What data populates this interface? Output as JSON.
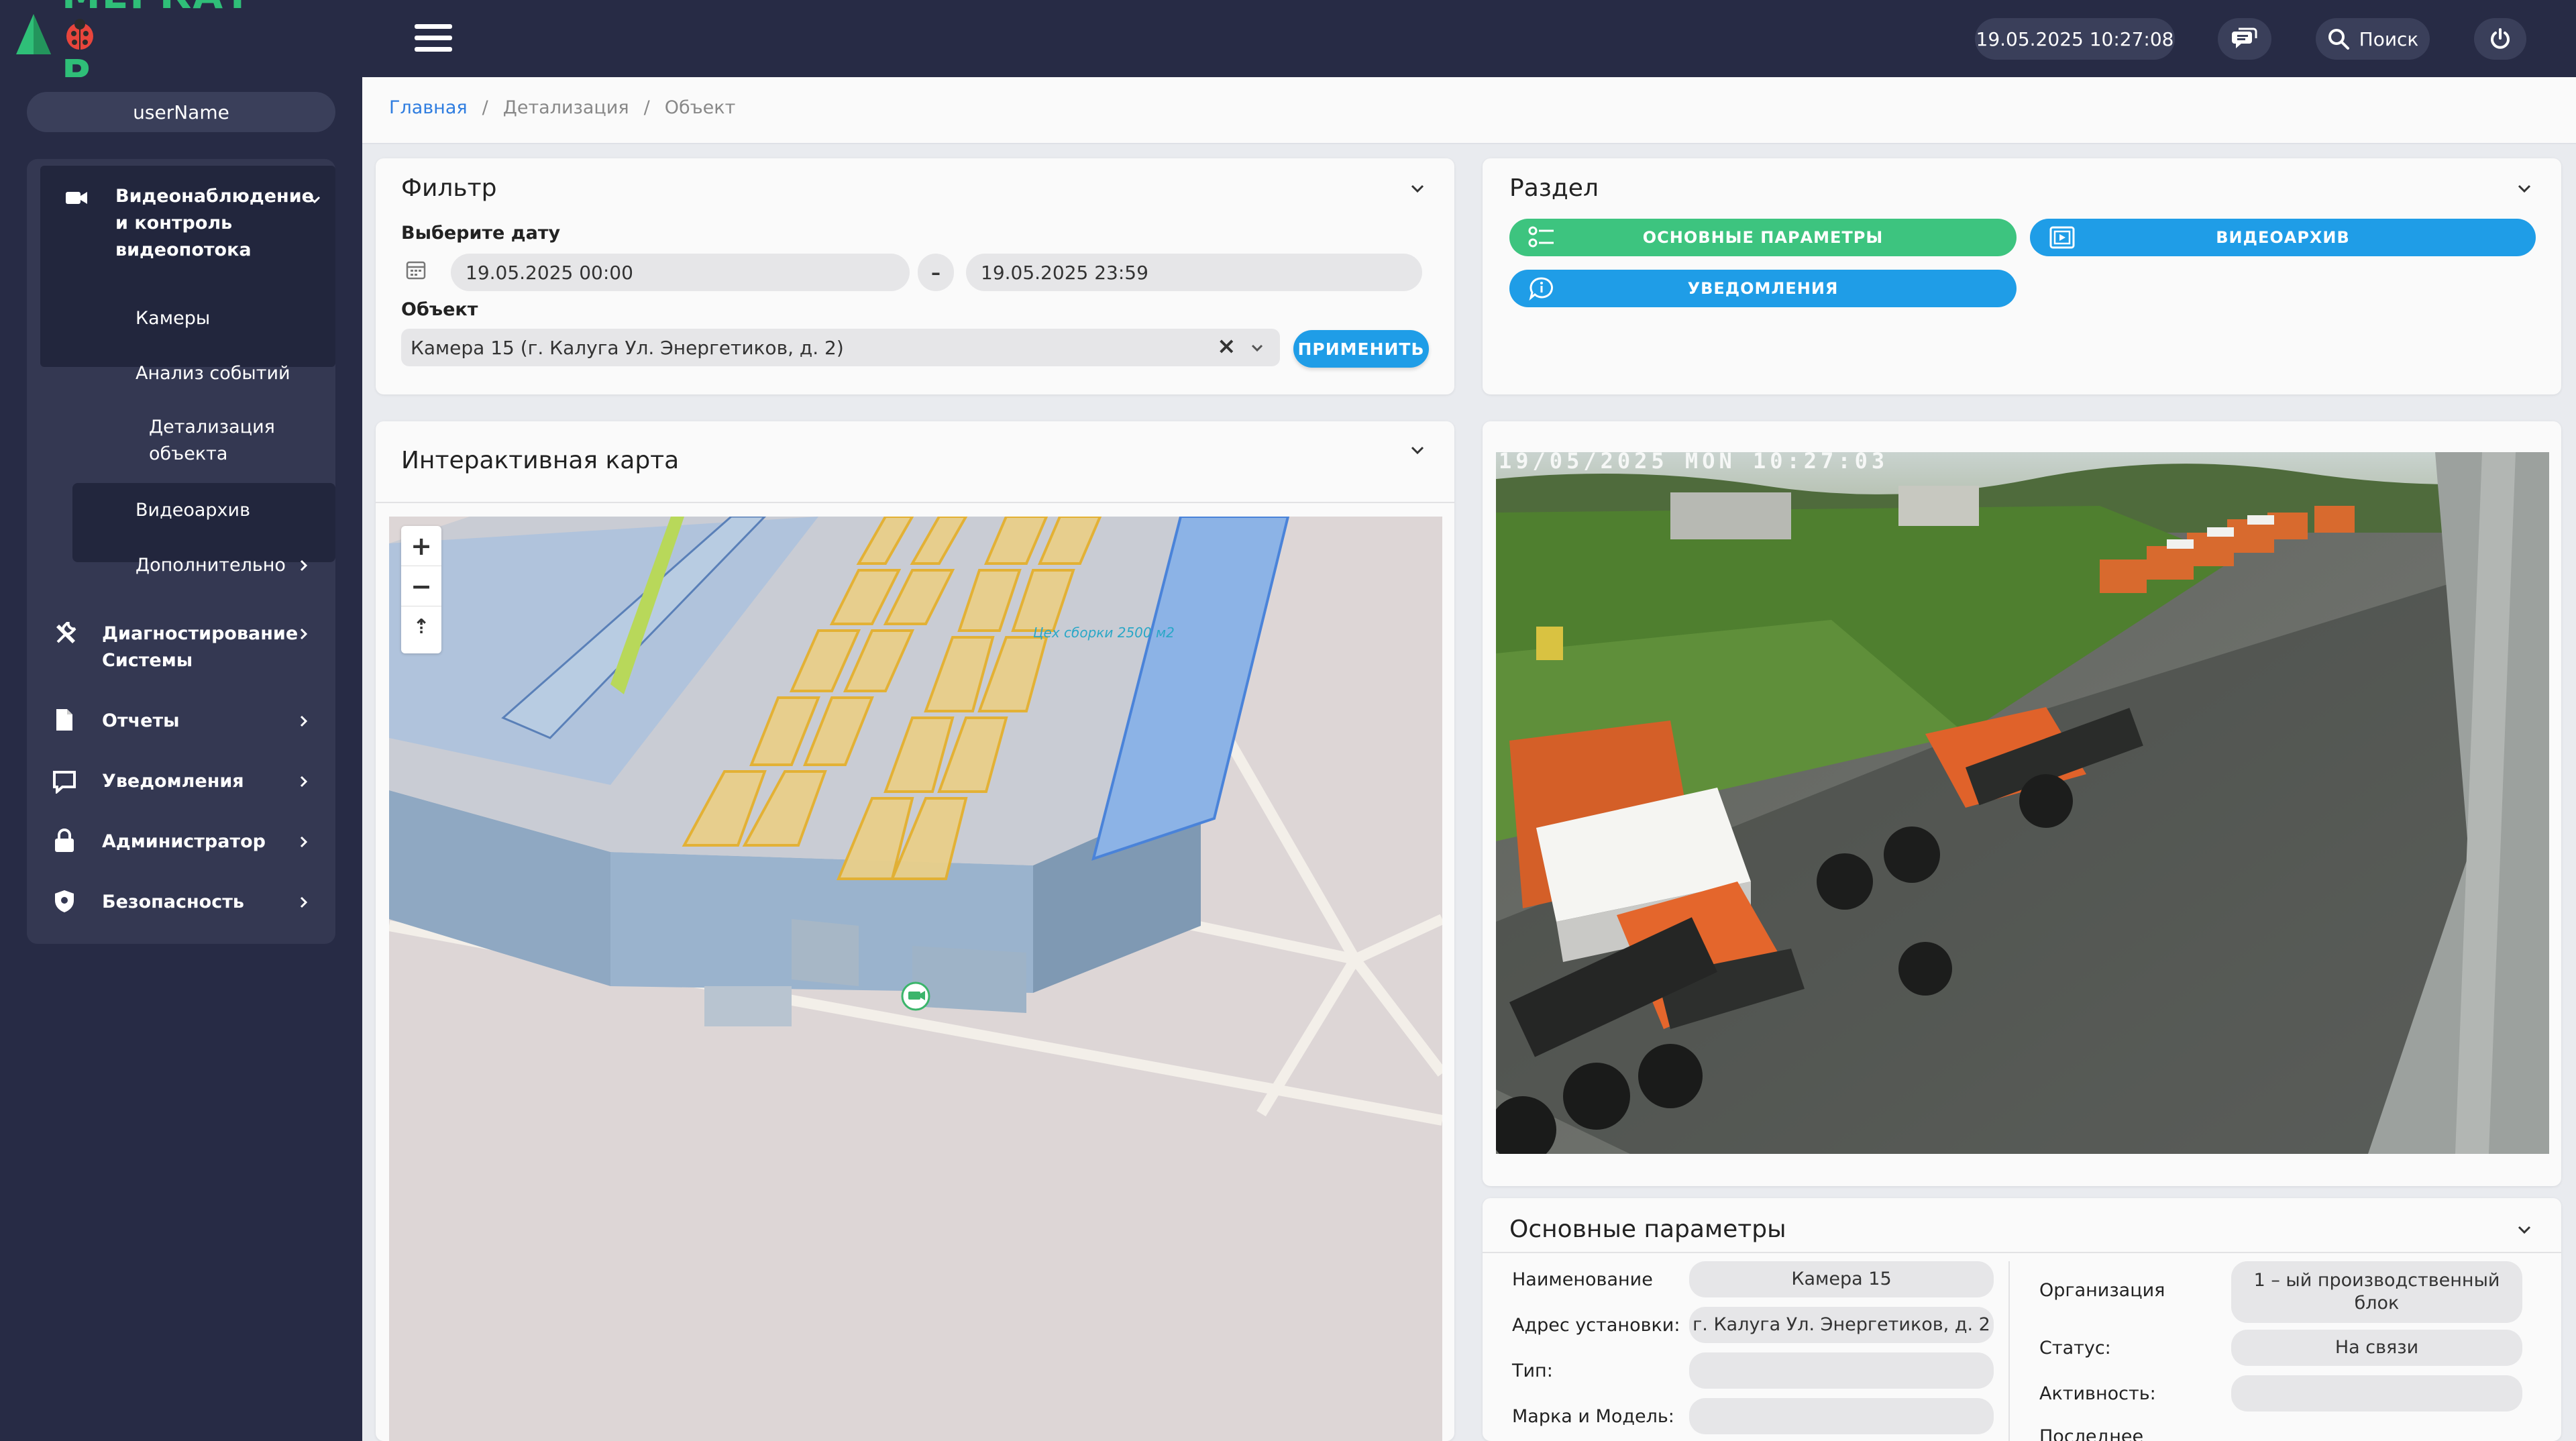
{
  "app": {
    "logo_text": "МЕРКАТ",
    "logo_text_tail": "Р"
  },
  "header": {
    "datetime": "19.05.2025 10:27:08",
    "search_label": "Поиск"
  },
  "sidebar": {
    "user": "userName",
    "items": [
      {
        "label_line1": "Видеонаблюдение",
        "label_line2": "и контроль",
        "label_line3": "видеопотока",
        "icon": "camera-icon"
      },
      {
        "label": "Камеры"
      },
      {
        "label": "Анализ событий"
      },
      {
        "label_line1": "Детализация",
        "label_line2": "объекта"
      },
      {
        "label": "Видеоархив"
      },
      {
        "label": "Дополнительно"
      },
      {
        "label_line1": "Диагностирование",
        "label_line2": "Системы",
        "icon": "tools-icon"
      },
      {
        "label": "Отчеты",
        "icon": "document-icon"
      },
      {
        "label": "Уведомления",
        "icon": "message-icon"
      },
      {
        "label": "Администратор",
        "icon": "lock-icon"
      },
      {
        "label": "Безопасность",
        "icon": "shield-icon"
      }
    ]
  },
  "breadcrumb": {
    "home": "Главная",
    "level2": "Детализация",
    "current": "Объект",
    "sep": "/"
  },
  "filter": {
    "title": "Фильтр",
    "date_label": "Выберите дату",
    "date_from": "19.05.2025 00:00",
    "date_to": "19.05.2025 23:59",
    "date_sep": "–",
    "object_label": "Объект",
    "object_value": "Камера 15 (г. Калуга Ул. Энергетиков, д. 2)",
    "clear_icon": "×",
    "apply_label": "ПРИМЕНИТЬ"
  },
  "section": {
    "title": "Раздел",
    "btn_params": "ОСНОВНЫЕ ПАРАМЕТРЫ",
    "btn_archive": "ВИДЕОАРХИВ",
    "btn_notifications": "УВЕДОМЛЕНИЯ",
    "colors": {
      "green": "#3dc47f",
      "blue": "#1f9de7"
    }
  },
  "map": {
    "title": "Интерактивная карта",
    "zoom_in": "+",
    "zoom_out": "−",
    "north": "⇡",
    "building_label": "Цех сборки 2500 м2"
  },
  "video": {
    "osd": "19/05/2025 MON 10:27:03"
  },
  "params": {
    "title": "Основные параметры",
    "name_label": "Наименование",
    "name_value": "Камера 15",
    "address_label": "Адрес установки:",
    "address_value": "г. Калуга Ул. Энергетиков, д. 2",
    "type_label": "Тип:",
    "type_value": "",
    "model_label": "Марка и Модель:",
    "model_value": "",
    "org_label": "Организация",
    "org_value_line1": "1 – ый производственный",
    "org_value_line2": "блок",
    "status_label": "Статус:",
    "status_value": "На связи",
    "activity_label": "Активность:",
    "activity_value": "",
    "last_label": "Последнее"
  }
}
